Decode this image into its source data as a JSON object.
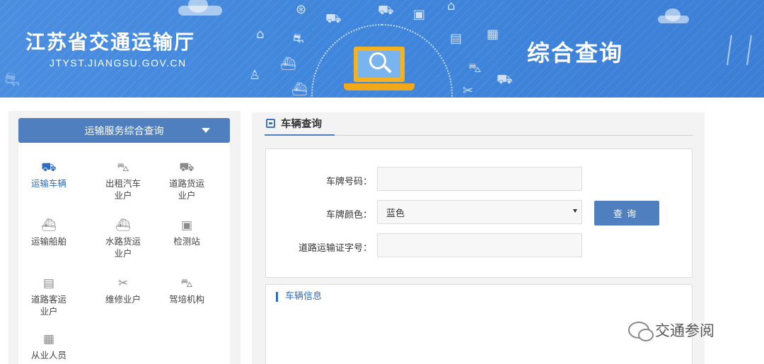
{
  "banner": {
    "title": "江苏省交通运输厅",
    "url": "JTYST.JIANGSU.GOV.CN",
    "heading": "综合查询"
  },
  "sidebar": {
    "header_label": "运输服务综合查询",
    "items": [
      {
        "label": "运输车辆",
        "icon": "vehicle-check-icon",
        "active": true
      },
      {
        "label": "出租汽车业户",
        "icon": "taxi-icon",
        "active": false
      },
      {
        "label": "道路货运业户",
        "icon": "truck-icon",
        "active": false
      },
      {
        "label": "运输船舶",
        "icon": "ship-icon",
        "active": false
      },
      {
        "label": "水路货运业户",
        "icon": "cargo-ship-icon",
        "active": false
      },
      {
        "label": "检测站",
        "icon": "inspection-icon",
        "active": false
      },
      {
        "label": "道路客运业户",
        "icon": "bus-icon",
        "active": false
      },
      {
        "label": "维修业户",
        "icon": "repair-tools-icon",
        "active": false
      },
      {
        "label": "驾培机构",
        "icon": "driving-school-icon",
        "active": false
      },
      {
        "label": "从业人员",
        "icon": "id-card-icon",
        "active": false
      }
    ]
  },
  "main": {
    "tab_label": "车辆查询",
    "form": {
      "plate_number_label": "车牌号码：",
      "plate_number_value": "",
      "plate_color_label": "车牌颜色：",
      "plate_color_value": "蓝色",
      "permit_label": "道路运输证字号：",
      "permit_value": "",
      "query_button": "查询"
    },
    "info_title": "车辆信息"
  },
  "watermark": "交通参阅",
  "colors": {
    "banner_blue": "#3f86dc",
    "accent_blue": "#4f7fbf",
    "active_text": "#2d6cc0"
  }
}
